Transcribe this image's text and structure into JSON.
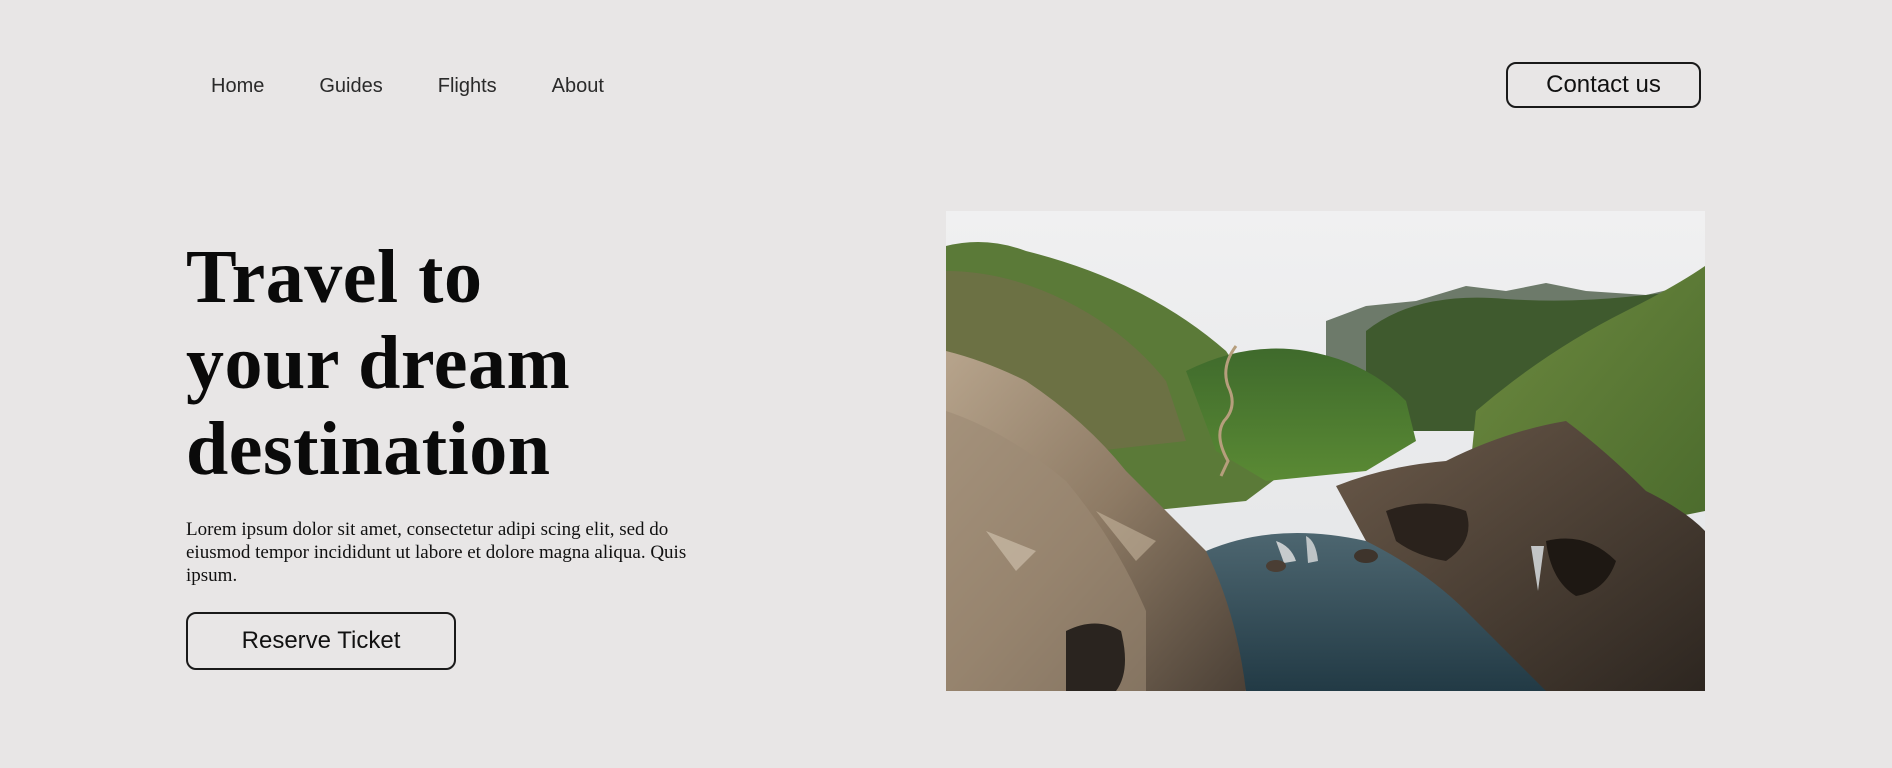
{
  "nav": {
    "items": [
      {
        "label": "Home"
      },
      {
        "label": "Guides"
      },
      {
        "label": "Flights"
      },
      {
        "label": "About"
      }
    ],
    "contact_label": "Contact us"
  },
  "hero": {
    "title_lines": [
      "Travel to",
      "your dream",
      "destination"
    ],
    "description": "Lorem ipsum dolor sit amet, consectetur adipi scing elit, sed do eiusmod tempor incididunt ut labore et dolore magna aliqua. Quis ipsum.",
    "cta_label": "Reserve Ticket",
    "image_alt": "coastal-cliffs-landscape-photo"
  },
  "colors": {
    "background": "#e8e6e6",
    "text": "#0a0a0a",
    "border": "#1a1a1a",
    "sky": "#e9ebec",
    "grass": "#5f7a3a",
    "rock": "#8a7a66",
    "water": "#2f4a55"
  }
}
